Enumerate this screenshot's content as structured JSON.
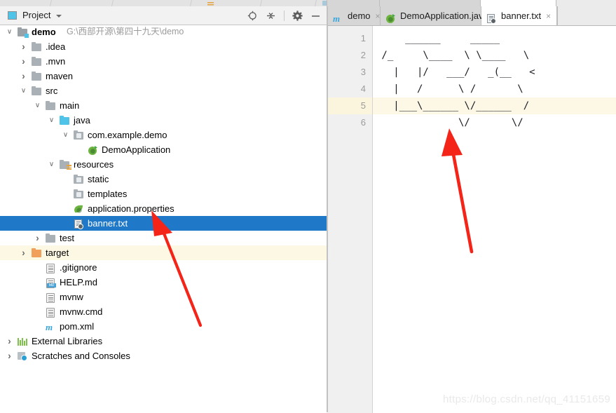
{
  "window": {
    "tool_window_title": "Project",
    "tool_window_actions": [
      "locate-icon",
      "collapse-all-icon",
      "settings-gear-icon",
      "hide-icon"
    ]
  },
  "project_tree": [
    {
      "label": "demo",
      "suffix": "G:\\西部开源\\第四十九天\\demo",
      "indent": 0,
      "arrow": "open",
      "icon": "module-folder-icon",
      "bold": true,
      "state": "normal"
    },
    {
      "label": ".idea",
      "suffix": "",
      "indent": 1,
      "arrow": "closed",
      "icon": "folder-icon",
      "bold": false,
      "state": "normal"
    },
    {
      "label": ".mvn",
      "suffix": "",
      "indent": 1,
      "arrow": "closed",
      "icon": "folder-icon",
      "bold": false,
      "state": "normal"
    },
    {
      "label": "maven",
      "suffix": "",
      "indent": 1,
      "arrow": "closed",
      "icon": "folder-icon",
      "bold": false,
      "state": "normal"
    },
    {
      "label": "src",
      "suffix": "",
      "indent": 1,
      "arrow": "open",
      "icon": "folder-icon",
      "bold": false,
      "state": "normal"
    },
    {
      "label": "main",
      "suffix": "",
      "indent": 2,
      "arrow": "open",
      "icon": "folder-icon",
      "bold": false,
      "state": "normal"
    },
    {
      "label": "java",
      "suffix": "",
      "indent": 3,
      "arrow": "open",
      "icon": "source-root-folder-icon",
      "bold": false,
      "state": "normal"
    },
    {
      "label": "com.example.demo",
      "suffix": "",
      "indent": 4,
      "arrow": "open",
      "icon": "package-icon",
      "bold": false,
      "state": "normal"
    },
    {
      "label": "DemoApplication",
      "suffix": "",
      "indent": 5,
      "arrow": "none",
      "icon": "spring-class-icon",
      "bold": false,
      "state": "normal"
    },
    {
      "label": "resources",
      "suffix": "",
      "indent": 3,
      "arrow": "open",
      "icon": "resources-root-folder-icon",
      "bold": false,
      "state": "normal"
    },
    {
      "label": "static",
      "suffix": "",
      "indent": 4,
      "arrow": "none",
      "icon": "package-icon",
      "bold": false,
      "state": "normal"
    },
    {
      "label": "templates",
      "suffix": "",
      "indent": 4,
      "arrow": "none",
      "icon": "package-icon",
      "bold": false,
      "state": "normal"
    },
    {
      "label": "application.properties",
      "suffix": "",
      "indent": 4,
      "arrow": "none",
      "icon": "spring-properties-icon",
      "bold": false,
      "state": "normal"
    },
    {
      "label": "banner.txt",
      "suffix": "",
      "indent": 4,
      "arrow": "none",
      "icon": "banner-file-icon",
      "bold": false,
      "state": "selected"
    },
    {
      "label": "test",
      "suffix": "",
      "indent": 2,
      "arrow": "closed",
      "icon": "folder-icon",
      "bold": false,
      "state": "normal"
    },
    {
      "label": "target",
      "suffix": "",
      "indent": 1,
      "arrow": "closed",
      "icon": "excluded-folder-icon",
      "bold": false,
      "state": "highlighted"
    },
    {
      "label": ".gitignore",
      "suffix": "",
      "indent": 2,
      "arrow": "none",
      "icon": "text-file-icon",
      "bold": false,
      "state": "normal"
    },
    {
      "label": "HELP.md",
      "suffix": "",
      "indent": 2,
      "arrow": "none",
      "icon": "markdown-file-icon",
      "bold": false,
      "state": "normal"
    },
    {
      "label": "mvnw",
      "suffix": "",
      "indent": 2,
      "arrow": "none",
      "icon": "text-file-icon",
      "bold": false,
      "state": "normal"
    },
    {
      "label": "mvnw.cmd",
      "suffix": "",
      "indent": 2,
      "arrow": "none",
      "icon": "text-file-icon",
      "bold": false,
      "state": "normal"
    },
    {
      "label": "pom.xml",
      "suffix": "",
      "indent": 2,
      "arrow": "none",
      "icon": "maven-file-icon",
      "bold": false,
      "state": "normal"
    },
    {
      "label": "External Libraries",
      "suffix": "",
      "indent": 0,
      "arrow": "closed",
      "icon": "libraries-icon",
      "bold": false,
      "state": "normal"
    },
    {
      "label": "Scratches and Consoles",
      "suffix": "",
      "indent": 0,
      "arrow": "closed",
      "icon": "scratches-icon",
      "bold": false,
      "state": "normal"
    }
  ],
  "editor": {
    "tabs": [
      {
        "label": "demo",
        "icon": "maven-file-icon",
        "active": false,
        "close": "×"
      },
      {
        "label": "DemoApplication.java",
        "icon": "spring-class-icon",
        "active": false,
        "close": "×"
      },
      {
        "label": "banner.txt",
        "icon": "banner-file-icon",
        "active": true,
        "close": "×"
      }
    ],
    "line_numbers": [
      "1",
      "2",
      "3",
      "4",
      "5",
      "6"
    ],
    "caret_line": 5,
    "lines": [
      "     ______     _____",
      " /_     \\____  \\ \\____   \\",
      "   |   |/   ___/   _(__   <",
      "   |   /      \\ /       \\",
      "   |___\\______ \\/______  /",
      "              \\/       \\/"
    ]
  },
  "annotations": {
    "arrow_tree_target": "banner.txt",
    "arrow_editor_target": "banner-ascii-art"
  },
  "watermark": "https://blog.csdn.net/qq_41151659",
  "colors": {
    "selection_blue": "#1f78c8",
    "highlight_yellow": "#fdf8e3",
    "caret_row": "#fdf8e6",
    "gutter": "#f0f0f0",
    "tab_strip": "#d6d6d6",
    "arrow_red": "#f42419"
  }
}
